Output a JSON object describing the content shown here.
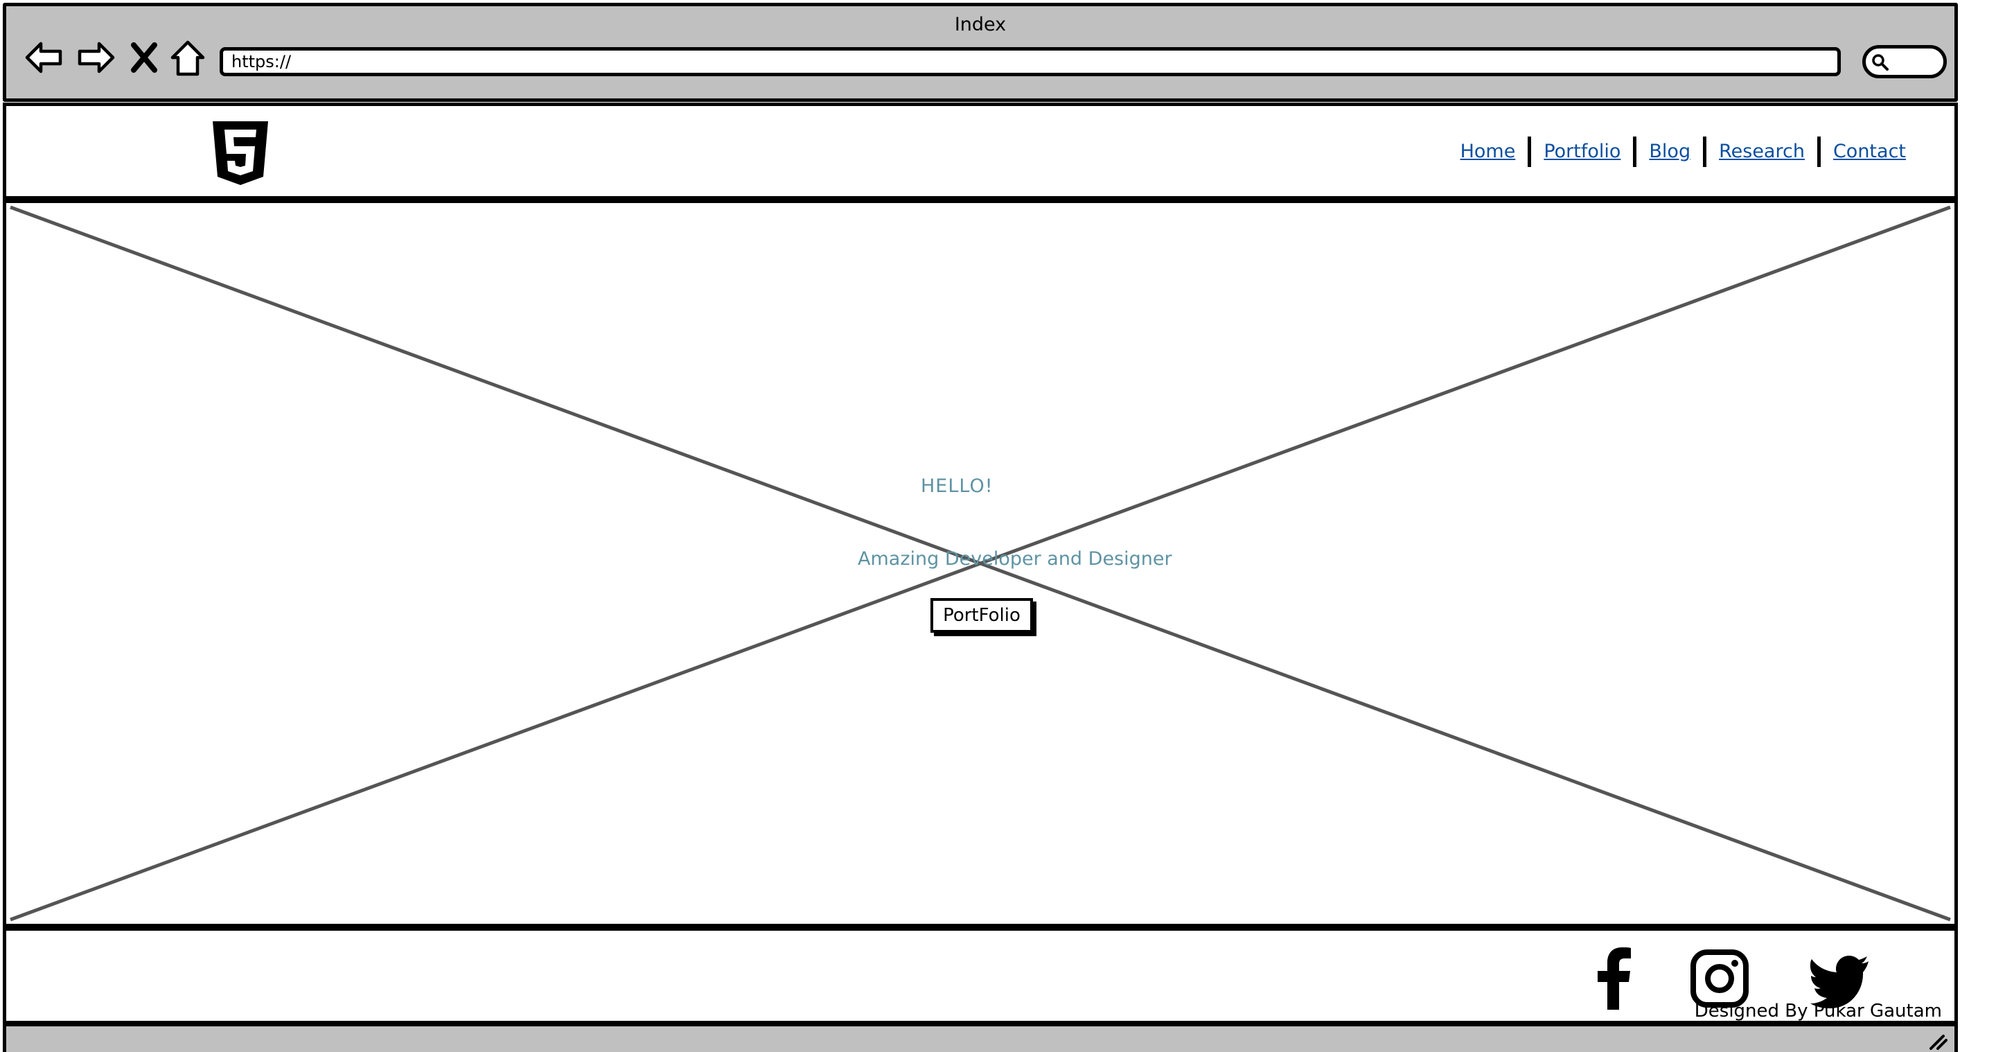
{
  "window": {
    "title": "Index"
  },
  "toolbar": {
    "back_icon": "back-arrow-icon",
    "forward_icon": "forward-arrow-icon",
    "stop_icon": "close-icon",
    "home_icon": "home-icon",
    "url_value": "https://",
    "search_icon": "search-icon"
  },
  "header": {
    "logo_icon": "html5-logo-icon",
    "nav": [
      {
        "label": "Home"
      },
      {
        "label": "Portfolio"
      },
      {
        "label": "Blog"
      },
      {
        "label": "Research"
      },
      {
        "label": "Contact"
      }
    ],
    "link_color": "#0b4fa0"
  },
  "hero": {
    "greeting": "HELLO!",
    "tagline": "Amazing Developer and Designer",
    "button_label": "PortFolio",
    "text_color": "#5f93a3",
    "placeholder": "image-placeholder"
  },
  "footer": {
    "social": [
      {
        "icon": "facebook-icon"
      },
      {
        "icon": "instagram-icon"
      },
      {
        "icon": "twitter-icon"
      }
    ],
    "credit": "Designed By Pukar Gautam"
  },
  "status_bar": {
    "grip_icon": "resize-grip-icon"
  },
  "colors": {
    "chrome": "#c0c0c0",
    "border": "#000000",
    "placeholder_lines": "#555555"
  }
}
